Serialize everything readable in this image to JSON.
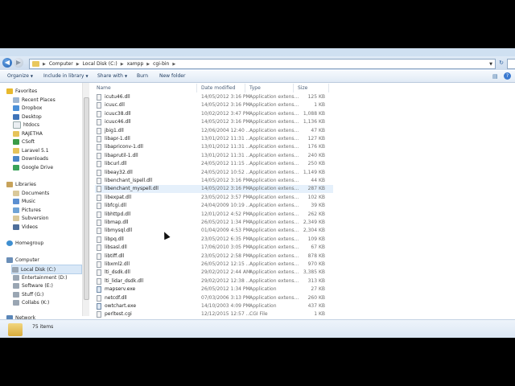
{
  "address": {
    "crumbs": [
      "Computer",
      "Local Disk (C:)",
      "xampp",
      "cgi-bin"
    ]
  },
  "toolbar": {
    "organize": "Organize",
    "include": "Include in library",
    "share": "Share with",
    "burn": "Burn",
    "new_folder": "New folder"
  },
  "nav": {
    "favorites_label": "Favorites",
    "favorites": [
      "Recent Places",
      "Dropbox",
      "Desktop",
      "htdocs",
      "RAJETHA",
      "CSoft",
      "Laravel 5.1",
      "Downloads",
      "Google Drive"
    ],
    "libraries_label": "Libraries",
    "libraries": [
      "Documents",
      "Music",
      "Pictures",
      "Subversion",
      "Videos"
    ],
    "homegroup_label": "Homegroup",
    "computer_label": "Computer",
    "drives": [
      "Local Disk (C:)",
      "Entertainment (D:)",
      "Software (E:)",
      "Stuff (G:)",
      "Collabs (K:)"
    ],
    "network_label": "Network"
  },
  "columns": {
    "name": "Name",
    "date": "Date modified",
    "type": "Type",
    "size": "Size"
  },
  "files": [
    {
      "name": "icutu46.dll",
      "date": "14/05/2012 3:16 PM",
      "type": "Application extens...",
      "size": "125 KB"
    },
    {
      "name": "icuuc.dll",
      "date": "14/05/2012 3:16 PM",
      "type": "Application extens...",
      "size": "1 KB"
    },
    {
      "name": "icuuc38.dll",
      "date": "10/02/2012 3:47 PM",
      "type": "Application extens...",
      "size": "1,088 KB"
    },
    {
      "name": "icuuc46.dll",
      "date": "14/05/2012 3:16 PM",
      "type": "Application extens...",
      "size": "1,136 KB"
    },
    {
      "name": "jbig1.dll",
      "date": "12/06/2004 12:40 ...",
      "type": "Application extens...",
      "size": "47 KB"
    },
    {
      "name": "libapr-1.dll",
      "date": "13/01/2012 11:31 ...",
      "type": "Application extens...",
      "size": "127 KB"
    },
    {
      "name": "libapriconv-1.dll",
      "date": "13/01/2012 11:31 ...",
      "type": "Application extens...",
      "size": "176 KB"
    },
    {
      "name": "libaprutil-1.dll",
      "date": "13/01/2012 11:31 ...",
      "type": "Application extens...",
      "size": "240 KB"
    },
    {
      "name": "libcurl.dll",
      "date": "24/05/2012 11:15 ...",
      "type": "Application extens...",
      "size": "250 KB"
    },
    {
      "name": "libeay32.dll",
      "date": "24/05/2012 10:52 ...",
      "type": "Application extens...",
      "size": "1,149 KB"
    },
    {
      "name": "libenchant_ispell.dll",
      "date": "14/05/2012 3:16 PM",
      "type": "Application extens...",
      "size": "44 KB"
    },
    {
      "name": "libenchant_myspell.dll",
      "date": "14/05/2012 3:16 PM",
      "type": "Application extens...",
      "size": "287 KB"
    },
    {
      "name": "libexpat.dll",
      "date": "23/05/2012 3:57 PM",
      "type": "Application extens...",
      "size": "102 KB"
    },
    {
      "name": "libfcgi.dll",
      "date": "24/04/2009 10:19 ...",
      "type": "Application extens...",
      "size": "39 KB"
    },
    {
      "name": "libhttpd.dll",
      "date": "12/01/2012 4:52 PM",
      "type": "Application extens...",
      "size": "262 KB"
    },
    {
      "name": "libmap.dll",
      "date": "26/05/2012 1:34 PM",
      "type": "Application extens...",
      "size": "2,349 KB"
    },
    {
      "name": "libmysql.dll",
      "date": "01/04/2009 4:53 PM",
      "type": "Application extens...",
      "size": "2,304 KB"
    },
    {
      "name": "libpq.dll",
      "date": "23/05/2012 6:35 PM",
      "type": "Application extens...",
      "size": "109 KB"
    },
    {
      "name": "libsasl.dll",
      "date": "17/06/2010 3:05 PM",
      "type": "Application extens...",
      "size": "67 KB"
    },
    {
      "name": "libtiff.dll",
      "date": "23/05/2012 2:58 PM",
      "type": "Application extens...",
      "size": "878 KB"
    },
    {
      "name": "libxml2.dll",
      "date": "26/05/2012 12:15 ...",
      "type": "Application extens...",
      "size": "970 KB"
    },
    {
      "name": "lti_dsdk.dll",
      "date": "29/02/2012 2:44 AM",
      "type": "Application extens...",
      "size": "3,385 KB"
    },
    {
      "name": "lti_lidar_dsdk.dll",
      "date": "29/02/2012 12:38 ...",
      "type": "Application extens...",
      "size": "313 KB"
    },
    {
      "name": "mapserv.exe",
      "date": "26/05/2012 1:34 PM",
      "type": "Application",
      "size": "27 KB"
    },
    {
      "name": "netcdf.dll",
      "date": "07/03/2006 3:13 PM",
      "type": "Application extens...",
      "size": "260 KB"
    },
    {
      "name": "owtchart.exe",
      "date": "14/10/2003 4:09 PM",
      "type": "Application",
      "size": "437 KB"
    },
    {
      "name": "perltest.cgi",
      "date": "12/12/2015 12:57 ...",
      "type": "CGI File",
      "size": "1 KB"
    }
  ],
  "status": {
    "count": "75 items"
  }
}
